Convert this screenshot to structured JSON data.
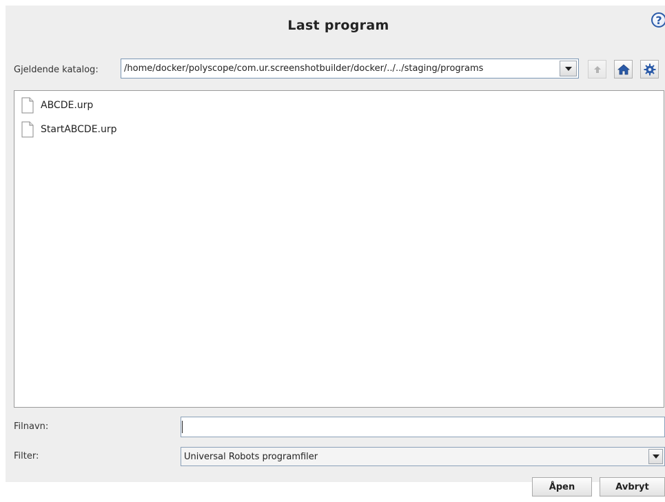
{
  "dialog": {
    "title": "Last program",
    "help_symbol": "?"
  },
  "directory": {
    "label": "Gjeldende katalog:",
    "path": "/home/docker/polyscope/com.ur.screenshotbuilder/docker/../../staging/programs"
  },
  "icons": {
    "help": "help-icon",
    "dropdown": "chevron-down-icon",
    "up": "arrow-up-icon",
    "home": "home-icon",
    "settings": "gear-icon",
    "file": "file-icon"
  },
  "files": [
    {
      "name": "ABCDE.urp"
    },
    {
      "name": "StartABCDE.urp"
    }
  ],
  "filename": {
    "label": "Filnavn:",
    "value": ""
  },
  "filter": {
    "label": "Filter:",
    "selected": "Universal Robots programfiler"
  },
  "buttons": {
    "open": "Åpen",
    "cancel": "Avbryt"
  },
  "colors": {
    "accent": "#2a5aa8",
    "background": "#eeeeee",
    "field_border": "#7a96b4"
  }
}
